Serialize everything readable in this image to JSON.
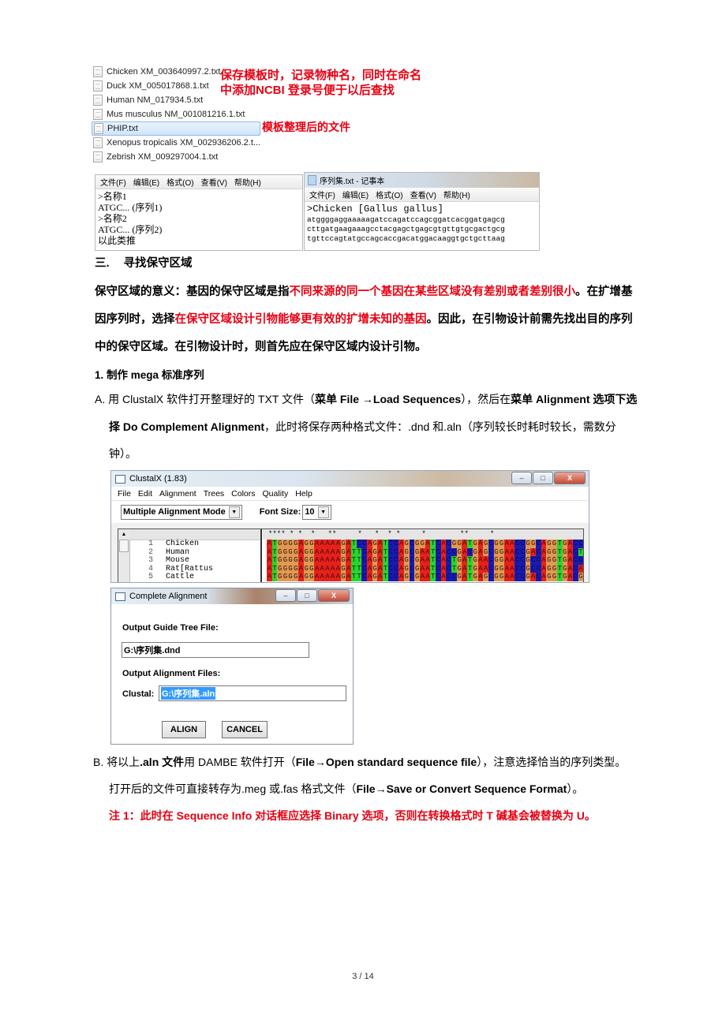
{
  "explorer": {
    "files": [
      {
        "name": "Chicken  XM_003640997.2.txt",
        "selected": false
      },
      {
        "name": "Duck XM_005017868.1.txt",
        "selected": false
      },
      {
        "name": "Human NM_017934.5.txt",
        "selected": false
      },
      {
        "name": "Mus musculus NM_001081216.1.txt",
        "selected": false
      },
      {
        "name": "PHIP.txt",
        "selected": true
      },
      {
        "name": "Xenopus tropicalis XM_002936206.2.t...",
        "selected": false
      },
      {
        "name": "Zebrish XM_009297004.1.txt",
        "selected": false
      }
    ],
    "annotation_line1": "保存模板时，记录物种名，同时在命名",
    "annotation_line2_pre": "中添加",
    "annotation_line2_ncbi": "NCBI",
    "annotation_line2_post": " 登录号便于以后查找",
    "annotation_phip": "模板整理后的文件"
  },
  "notepad_template": {
    "menu": [
      "文件(F)",
      "编辑(E)",
      "格式(O)",
      "查看(V)",
      "帮助(H)"
    ],
    "lines": [
      ">名称1",
      "ATGC... (序列1)",
      ">名称2",
      "ATGC... (序列2)",
      "以此类推"
    ]
  },
  "notepad_file": {
    "title": "序列集.txt - 记事本",
    "menu": [
      "文件(F)",
      "编辑(E)",
      "格式(O)",
      "查看(V)",
      "帮助(H)"
    ],
    "header": ">Chicken [Gallus gallus]",
    "lines": [
      "atggggaggaaaaagatccagatccagcggatcacggatgagcg",
      "cttgatgaagaaagcctacgagctgagcgtgttgtgcgactgcg",
      "tgttccagtatgccagcaccgacatggacaaggtgctgcttaag"
    ]
  },
  "section3": {
    "heading_num": "三.",
    "heading": "寻找保守区域",
    "p1_a": "保守区域的意义：基因的保守区域是指",
    "p1_red": "不同来源的同一个基因在某些区域没有差别或者差别很小",
    "p1_b": "。在扩增基",
    "p2_a": "因序列时，选择",
    "p2_red": "在保守区域设计引物能够更有效的扩增未知的基因",
    "p2_b": "。因此，在引物设计前需先找出目的序列",
    "p3": "中的保守区域。在引物设计时，则首先应在保守区域内设计引物。"
  },
  "step1": {
    "title": "1. 制作 mega 标准序列",
    "A": {
      "label": "A.",
      "l1_a": "用 ClustalX 软件打开整理好的 TXT 文件（",
      "l1_b1": "菜单 File  →Load Sequences",
      "l1_c": "），然后在",
      "l1_b2": "菜单 Alignment 选项下选",
      "l2_b": "择 Do Complement Alignment",
      "l2_a": "，此时将保存两种格式文件：.dnd 和.aln（序列较长时耗时较长，需数分",
      "l3": "钟）。"
    },
    "B": {
      "label": "B.",
      "l1_a": "将以上",
      "l1_b1": ".aln 文件",
      "l1_c": "用 DAMBE 软件打开（",
      "l1_b2": "File→Open standard sequence file",
      "l1_d": "），注意选择恰当的序列类型。",
      "l2_a": "打开后的文件可直接转存为.meg 或.fas 格式文件（",
      "l2_b": "File→Save or Convert Sequence Format",
      "l2_c": "）。"
    },
    "note1": "注 1：此时在 Sequence Info 对话框应选择 Binary 选项，否则在转换格式时 T 碱基会被替换为 U。"
  },
  "clustalx": {
    "title": "ClustalX (1.83)",
    "menu": [
      "File",
      "Edit",
      "Alignment",
      "Trees",
      "Colors",
      "Quality",
      "Help"
    ],
    "mode": "Multiple Alignment Mode",
    "font_size_label": "Font Size:",
    "font_size": "10",
    "conservation": "**** * *  *   **     *   *  * *     *        **     *",
    "sequences": [
      {
        "num": "1",
        "name": "Chicken",
        "seq": "ATGGGGAGGAAAAAGATCCAGATCCAGCGGATCACGGATGAGCGGAACCGGCAGGTGACC"
      },
      {
        "num": "2",
        "name": "Human",
        "seq": "ATGGGGAGGAAAAAGATTCAGATCCAGCGAATCACCGACGAGCGGAACCGACAGGTGACT"
      },
      {
        "num": "3",
        "name": "Mouse",
        "seq": "ATGGGGAGGAAAAAGATTCAGATCCAGCGAATCACTGATGAACGGAACCGCCAGGTGACC"
      },
      {
        "num": "4",
        "name": "Rat[Rattus",
        "seq": "ATGGGGAGGAAAAAGATTCAGATCCAGCGAATCACTGATGAACGGAACCGCCAGGTGACA"
      },
      {
        "num": "5",
        "name": "Cattle",
        "seq": "ATGGGGAGGAAAAAGATTCAGATCCAGCGAATCACCGATGAGCGGAACCGACAGGTGACG"
      }
    ],
    "base_colors": {
      "A": "#e8201a",
      "T": "#22d92a",
      "G": "#e09a52",
      "C": "#1a1ab0"
    }
  },
  "complete_alignment": {
    "title": "Complete Alignment",
    "guide_tree_label": "Output Guide Tree File:",
    "guide_tree_value": "G:\\序列集.dnd",
    "alignment_files_label": "Output Alignment Files:",
    "clustal_label": "Clustal:",
    "clustal_value": "G:\\序列集.aln",
    "align_button": "ALIGN",
    "cancel_button": "CANCEL"
  },
  "footer": {
    "page": "3 / 14"
  }
}
